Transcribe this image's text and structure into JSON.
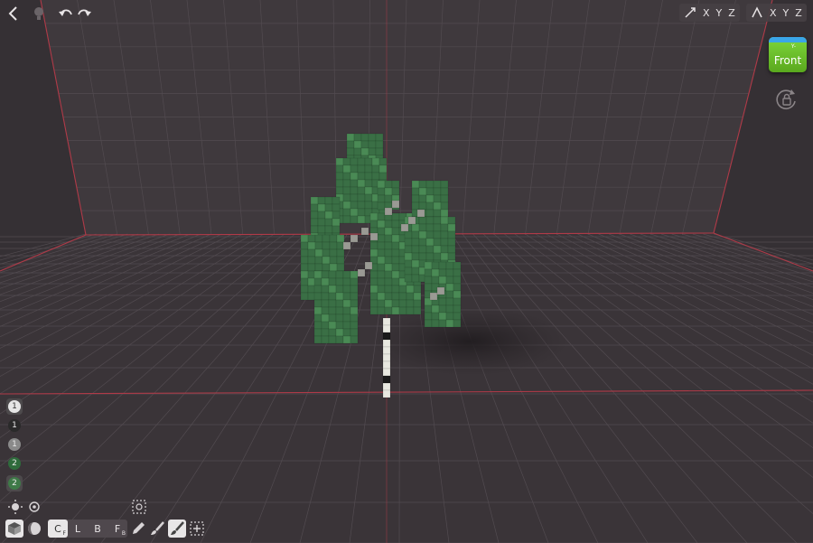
{
  "toolbar": {
    "axis_group_1": [
      "X",
      "Y",
      "Z"
    ],
    "axis_group_2": [
      "X",
      "Y",
      "Z"
    ]
  },
  "view_cube": {
    "label": "Front",
    "axis_tag": "Y-"
  },
  "layers": [
    {
      "label": "1",
      "color": "#e6e6e6",
      "selected": true
    },
    {
      "label": "1",
      "color": "#2a2a2a",
      "selected": false
    },
    {
      "label": "1",
      "color": "#8a8a8a",
      "selected": false
    },
    {
      "label": "2",
      "color": "#2f6b3c",
      "selected": false
    },
    {
      "label": "2",
      "color": "#3f7a48",
      "selected": true
    }
  ],
  "modes": [
    {
      "label": "C",
      "sub": "F"
    },
    {
      "label": "L",
      "sub": ""
    },
    {
      "label": "B",
      "sub": ""
    },
    {
      "label": "F",
      "sub": "B"
    }
  ],
  "colors": {
    "background": "#3b3539",
    "grid": "#5a5458",
    "axis_line": "#c0404c",
    "foliage": "#3a6f45",
    "foliage_light": "#4a8a55",
    "trunk": "#e8e8e0",
    "view_cube": "#6cc02a"
  }
}
